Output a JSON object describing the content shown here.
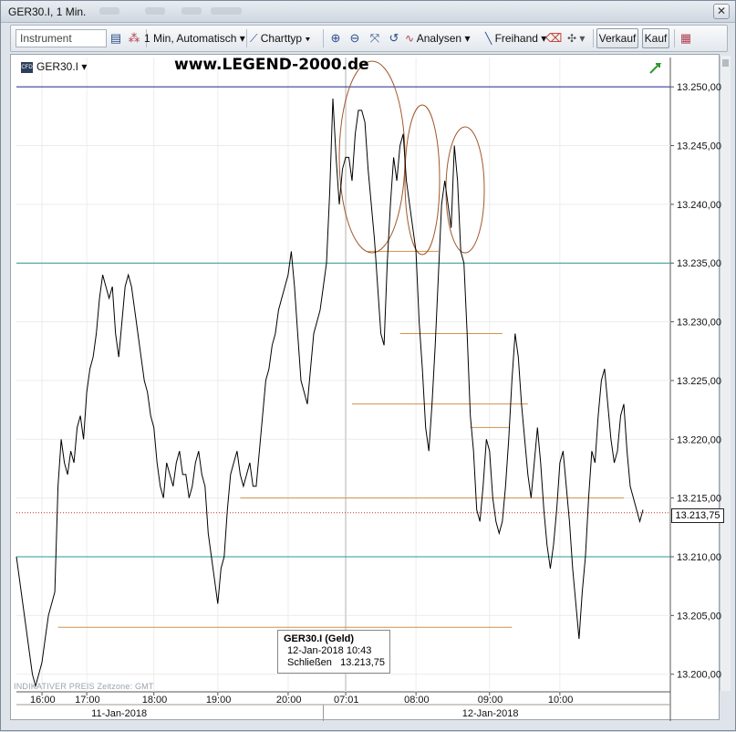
{
  "window": {
    "title": "GER30.I, 1 Min."
  },
  "toolbar": {
    "instrument_placeholder": "Instrument",
    "interval_label": "1 Min,  Automatisch",
    "charttyp_label": "Charttyp",
    "analysen_label": "Analysen",
    "freihand_label": "Freihand",
    "verkauf_label": "Verkauf",
    "kauf_label": "Kauf"
  },
  "chart_header": {
    "symbol": "GER30.I",
    "watermark": "www.LEGEND-2000.de"
  },
  "price_badge": "13.213,75",
  "tooltip": {
    "title": "GER30.I (Geld)",
    "datetime": "12-Jan-2018 10:43",
    "close_label": "Schließen",
    "close_value": "13.213,75"
  },
  "footer_note": "INDIKATIVER PREIS   Zeitzone: GMT",
  "colors": {
    "price_line": "#000000",
    "support_lines": "#2a9a9a",
    "top_line": "#1f2a8c",
    "horizontal_orange": "#d2914e",
    "ellipse": "#a0582a",
    "current_price_line": "#c0392b"
  },
  "chart_data": {
    "type": "line",
    "title": "GER30.I, 1 Min.",
    "y_ticks": [
      "13.250,00",
      "13.245,00",
      "13.240,00",
      "13.235,00",
      "13.230,00",
      "13.225,00",
      "13.220,00",
      "13.215,00",
      "13.210,00",
      "13.205,00",
      "13.200,00"
    ],
    "ylim": [
      13198.5,
      13252.5
    ],
    "x_ticks": [
      "16:00",
      "17:00",
      "18:00",
      "19:00",
      "20:00",
      "07:01",
      "08:00",
      "09:00",
      "10:00"
    ],
    "date_labels": [
      "11-Jan-2018",
      "12-Jan-2018"
    ],
    "horizontal_levels": {
      "top": 13250.0,
      "upper_support": 13235.0,
      "lower_support": 13210.0,
      "current": 13213.75
    },
    "series": [
      {
        "name": "GER30.I",
        "values": [
          13210,
          13208,
          13206,
          13204,
          13202,
          13200,
          13199,
          13200,
          13201,
          13203,
          13205,
          13206,
          13207,
          13216,
          13220,
          13218,
          13217,
          13219,
          13218,
          13221,
          13222,
          13220,
          13224,
          13226,
          13227,
          13229,
          13232,
          13234,
          13233,
          13232,
          13233,
          13229,
          13227,
          13230,
          13233,
          13234,
          13233,
          13231,
          13229,
          13227,
          13225,
          13224,
          13222,
          13221,
          13218,
          13216,
          13215,
          13218,
          13217,
          13216,
          13218,
          13219,
          13217,
          13217,
          13215,
          13216,
          13218,
          13219,
          13217,
          13216,
          13212,
          13210,
          13208,
          13206,
          13209,
          13210,
          13214,
          13217,
          13218,
          13219,
          13217,
          13216,
          13217,
          13218,
          13216,
          13216,
          13219,
          13222,
          13225,
          13226,
          13228,
          13229,
          13231,
          13232,
          13233,
          13234,
          13236,
          13233,
          13229,
          13225,
          13224,
          13223,
          13226,
          13229,
          13230,
          13231,
          13233,
          13235,
          13241,
          13249,
          13244,
          13240,
          13243,
          13244,
          13244,
          13242,
          13246,
          13248,
          13248,
          13247,
          13243,
          13240,
          13237,
          13233,
          13229,
          13228,
          13235,
          13240,
          13244,
          13242,
          13245,
          13246,
          13242,
          13240,
          13238,
          13236,
          13230,
          13226,
          13221,
          13219,
          13223,
          13228,
          13234,
          13240,
          13242,
          13240,
          13238,
          13245,
          13242,
          13236,
          13235,
          13229,
          13222,
          13219,
          13214,
          13213,
          13216,
          13220,
          13219,
          13215,
          13213,
          13212,
          13213,
          13216,
          13220,
          13225,
          13229,
          13227,
          13223,
          13220,
          13217,
          13215,
          13218,
          13221,
          13218,
          13214,
          13211,
          13209,
          13211,
          13214,
          13218,
          13219,
          13216,
          13213,
          13209,
          13206,
          13203,
          13207,
          13210,
          13215,
          13219,
          13218,
          13222,
          13225,
          13226,
          13223,
          13220,
          13218,
          13219,
          13222,
          13223,
          13219,
          13216,
          13215,
          13214,
          13213,
          13214
        ]
      }
    ],
    "xlabel": "",
    "ylabel": "",
    "grid": true
  }
}
